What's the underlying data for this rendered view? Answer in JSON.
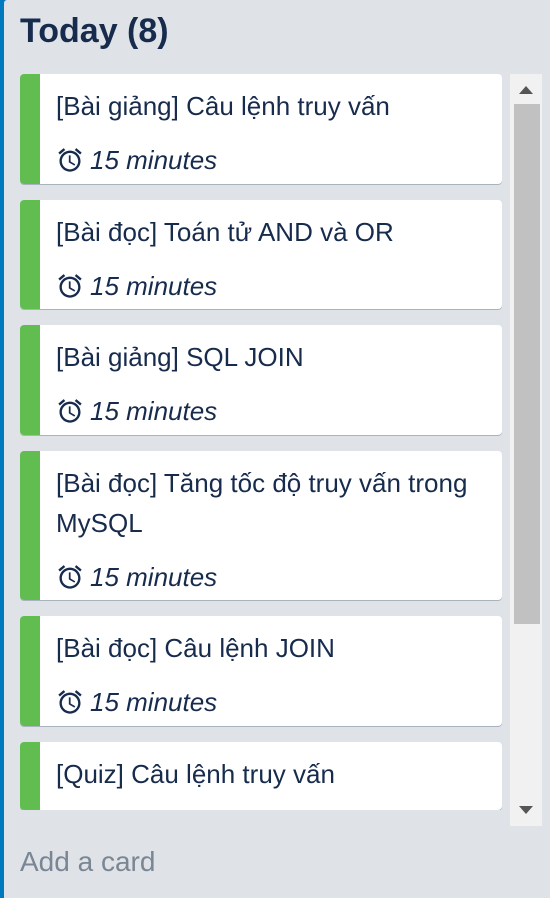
{
  "list": {
    "title": "Today (8)",
    "accent_color": "#61bd4f",
    "cards": [
      {
        "title": "[Bài giảng] Câu lệnh truy vấn",
        "icon": "alarm-clock-icon",
        "duration": "15 minutes"
      },
      {
        "title": "[Bài đọc] Toán tử AND và OR",
        "icon": "alarm-clock-icon",
        "duration": "15 minutes"
      },
      {
        "title": "[Bài giảng] SQL JOIN",
        "icon": "alarm-clock-icon",
        "duration": "15 minutes"
      },
      {
        "title": "[Bài đọc] Tăng tốc độ truy vấn trong MySQL",
        "icon": "alarm-clock-icon",
        "duration": "15 minutes"
      },
      {
        "title": "[Bài đọc] Câu lệnh JOIN",
        "icon": "alarm-clock-icon",
        "duration": "15 minutes"
      },
      {
        "title": "[Quiz] Câu lệnh truy vấn"
      }
    ],
    "add_card_label": "Add a card"
  }
}
